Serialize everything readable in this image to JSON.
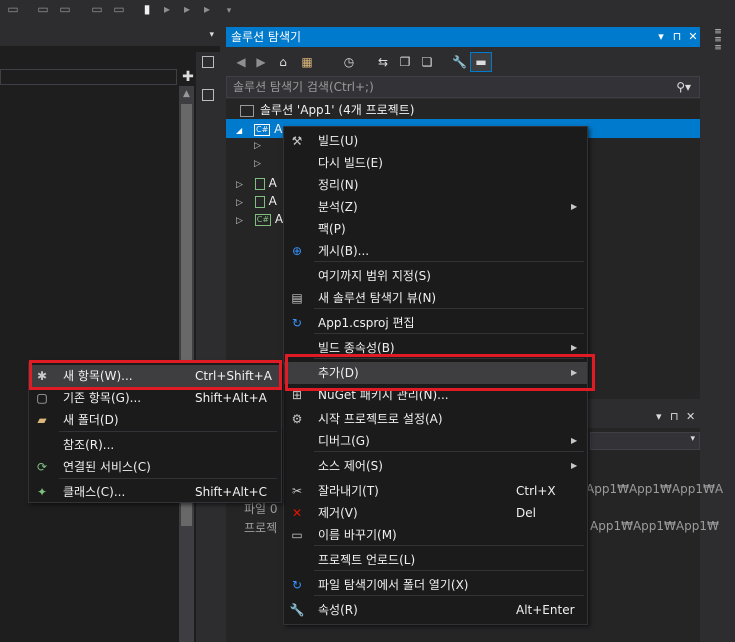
{
  "colors": {
    "accent": "#007acc",
    "highlight_box": "#e01b24",
    "menu_bg": "#1b1b1c"
  },
  "solution_explorer": {
    "title": "솔루션 탐색기",
    "title_pin": "⊓",
    "title_dropdown": "▾",
    "search_placeholder": "솔루션 탐색기 검색(Ctrl+;)",
    "search_icon": "🔍",
    "tree": [
      {
        "label": "솔루션 'App1' (4개 프로젝트)",
        "icon": "solution-icon"
      },
      {
        "label": "A",
        "icon": "csharp-project-icon"
      },
      {
        "label": "A",
        "icon": "project-icon"
      },
      {
        "label": "A",
        "icon": "project-icon"
      },
      {
        "label": "A",
        "icon": "csharp-project-icon"
      }
    ]
  },
  "lower_panel": {
    "lines": [
      "App1₩App1₩App1₩A",
      "App1₩App1₩App1₩",
      "파일 0",
      "프로젝"
    ]
  },
  "project_menu": [
    {
      "label": "빌드(U)",
      "icon": "build-icon",
      "shortcut": "",
      "submenu": false
    },
    {
      "label": "다시 빌드(E)",
      "icon": "",
      "shortcut": "",
      "submenu": false
    },
    {
      "label": "정리(N)",
      "icon": "",
      "shortcut": "",
      "submenu": false
    },
    {
      "label": "분석(Z)",
      "icon": "",
      "shortcut": "",
      "submenu": true
    },
    {
      "label": "팩(P)",
      "icon": "",
      "shortcut": "",
      "submenu": false
    },
    {
      "label": "게시(B)...",
      "icon": "globe-icon",
      "shortcut": "",
      "submenu": false
    },
    {
      "label": "여기까지 범위 지정(S)",
      "icon": "",
      "shortcut": "",
      "submenu": false
    },
    {
      "label": "새 솔루션 탐색기 뷰(N)",
      "icon": "new-view-icon",
      "shortcut": "",
      "submenu": false
    },
    {
      "label": "App1.csproj 편집",
      "icon": "edit-refresh-icon",
      "shortcut": "",
      "submenu": false
    },
    {
      "label": "빌드 종속성(B)",
      "icon": "",
      "shortcut": "",
      "submenu": true
    },
    {
      "label": "추가(D)",
      "icon": "",
      "shortcut": "",
      "submenu": true
    },
    {
      "label": "NuGet 패키지 관리(N)...",
      "icon": "nuget-icon",
      "shortcut": "",
      "submenu": false
    },
    {
      "label": "시작 프로젝트로 설정(A)",
      "icon": "gear-icon",
      "shortcut": "",
      "submenu": false
    },
    {
      "label": "디버그(G)",
      "icon": "",
      "shortcut": "",
      "submenu": true
    },
    {
      "label": "소스 제어(S)",
      "icon": "",
      "shortcut": "",
      "submenu": true
    },
    {
      "label": "잘라내기(T)",
      "icon": "scissors-icon",
      "shortcut": "Ctrl+X",
      "submenu": false
    },
    {
      "label": "제거(V)",
      "icon": "delete-x-icon",
      "shortcut": "Del",
      "submenu": false
    },
    {
      "label": "이름 바꾸기(M)",
      "icon": "rename-icon",
      "shortcut": "",
      "submenu": false
    },
    {
      "label": "프로젝트 언로드(L)",
      "icon": "",
      "shortcut": "",
      "submenu": false
    },
    {
      "label": "파일 탐색기에서 폴더 열기(X)",
      "icon": "open-folder-refresh-icon",
      "shortcut": "",
      "submenu": false
    },
    {
      "label": "속성(R)",
      "icon": "wrench-icon",
      "shortcut": "Alt+Enter",
      "submenu": false
    }
  ],
  "add_menu": [
    {
      "label": "새 항목(W)...",
      "icon": "new-item-icon",
      "shortcut": "Ctrl+Shift+A"
    },
    {
      "label": "기존 항목(G)...",
      "icon": "existing-item-icon",
      "shortcut": "Shift+Alt+A"
    },
    {
      "label": "새 폴더(D)",
      "icon": "new-folder-icon",
      "shortcut": ""
    },
    {
      "label": "참조(R)...",
      "icon": "",
      "shortcut": ""
    },
    {
      "label": "연결된 서비스(C)",
      "icon": "connected-service-icon",
      "shortcut": ""
    },
    {
      "label": "클래스(C)...",
      "icon": "class-icon",
      "shortcut": "Shift+Alt+C"
    }
  ]
}
